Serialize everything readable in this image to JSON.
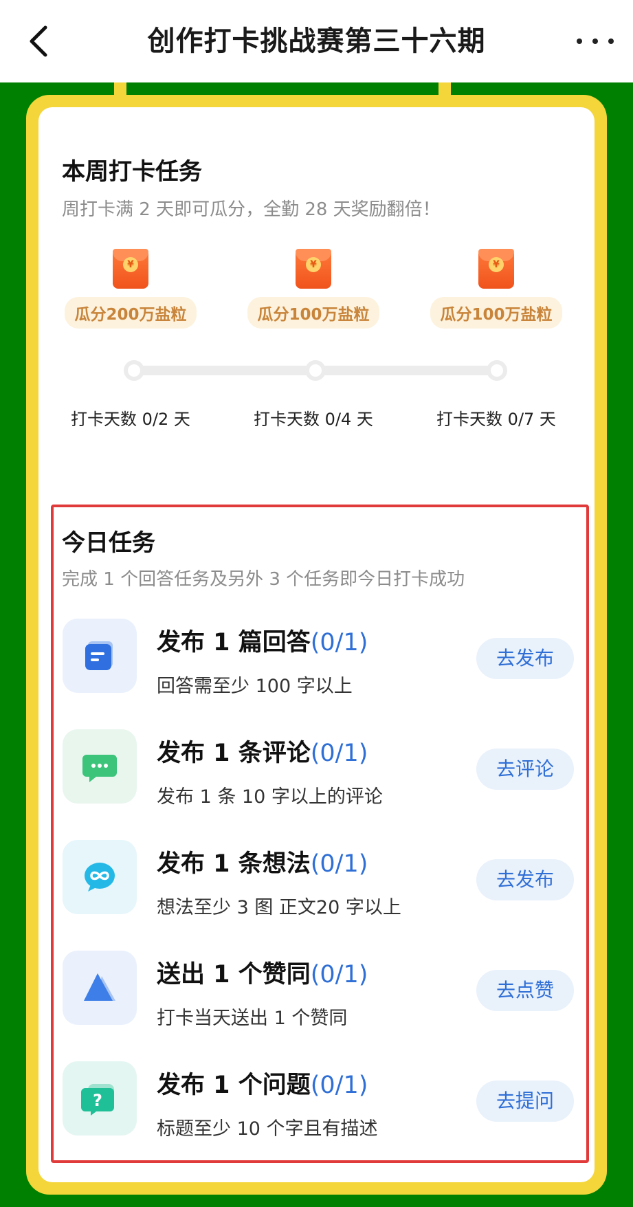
{
  "header": {
    "title": "创作打卡挑战赛第三十六期"
  },
  "weekly": {
    "title": "本周打卡任务",
    "subtitle": "周打卡满 2 天即可瓜分，全勤 28 天奖励翻倍！",
    "progress_fraction": 0,
    "rewards": [
      {
        "label": "瓜分200万盐粒",
        "days": "打卡天数 0/2 天"
      },
      {
        "label": "瓜分100万盐粒",
        "days": "打卡天数 0/4 天"
      },
      {
        "label": "瓜分100万盐粒",
        "days": "打卡天数 0/7 天"
      }
    ],
    "coin_symbol": "¥"
  },
  "today": {
    "title": "今日任务",
    "subtitle": "完成 1 个回答任务及另外 3 个任务即今日打卡成功",
    "tasks": [
      {
        "title": "发布 1 篇回答",
        "count": "(0/1)",
        "desc": "回答需至少 100 字以上",
        "button": "去发布",
        "icon": "document-icon"
      },
      {
        "title": "发布 1 条评论",
        "count": "(0/1)",
        "desc": "发布 1 条 10 字以上的评论",
        "button": "去评论",
        "icon": "comment-bubble-icon"
      },
      {
        "title": "发布 1 条想法",
        "count": "(0/1)",
        "desc": "想法至少 3 图 正文20 字以上",
        "button": "去发布",
        "icon": "idea-bubble-icon"
      },
      {
        "title": "送出 1 个赞同",
        "count": "(0/1)",
        "desc": "打卡当天送出 1 个赞同",
        "button": "去点赞",
        "icon": "upvote-triangle-icon"
      },
      {
        "title": "发布 1 个问题",
        "count": "(0/1)",
        "desc": "标题至少 10 个字且有描述",
        "button": "去提问",
        "icon": "question-icon"
      }
    ]
  },
  "colors": {
    "background_green": "#008000",
    "frame_yellow": "#f4d63a",
    "accent_blue": "#2f6fd6",
    "highlight_red": "#e13a3a"
  }
}
